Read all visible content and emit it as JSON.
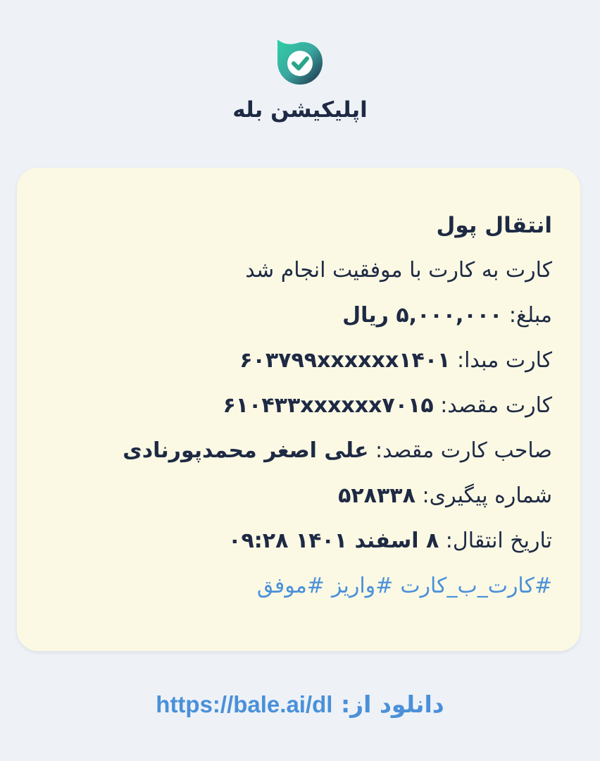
{
  "app": {
    "name": "اپلیکیشن بله",
    "logo_icon": "bale-check-icon",
    "brand_colors": {
      "dark": "#1e2a44",
      "accent": "#3dbf9a",
      "link": "#4a90d9"
    }
  },
  "card": {
    "title": "انتقال پول",
    "subtitle": "کارت به کارت با موفقیت انجام شد",
    "amount_label": "مبلغ: ",
    "amount_value": "۵,۰۰۰,۰۰۰ ریال",
    "source_label": "کارت مبدا: ",
    "source_value": "۶۰۳۷۹۹xxxxxx۱۴۰۱",
    "dest_label": "کارت مقصد: ",
    "dest_value": "۶۱۰۴۳۳xxxxxx۷۰۱۵",
    "owner_label": "صاحب کارت مقصد: ",
    "owner_value": "علی اصغر محمدپورنادی",
    "tracking_label": "شماره پیگیری: ",
    "tracking_value": "۵۲۸۳۳۸",
    "date_label": "تاریخ انتقال: ",
    "date_value": "۸ اسفند ۱۴۰۱ ۰۹:۲۸",
    "tags": [
      "#کارت_ب_کارت",
      "#واریز",
      "#موفق"
    ]
  },
  "footer": {
    "label": "دانلود از: ",
    "url": "https://bale.ai/dl"
  }
}
